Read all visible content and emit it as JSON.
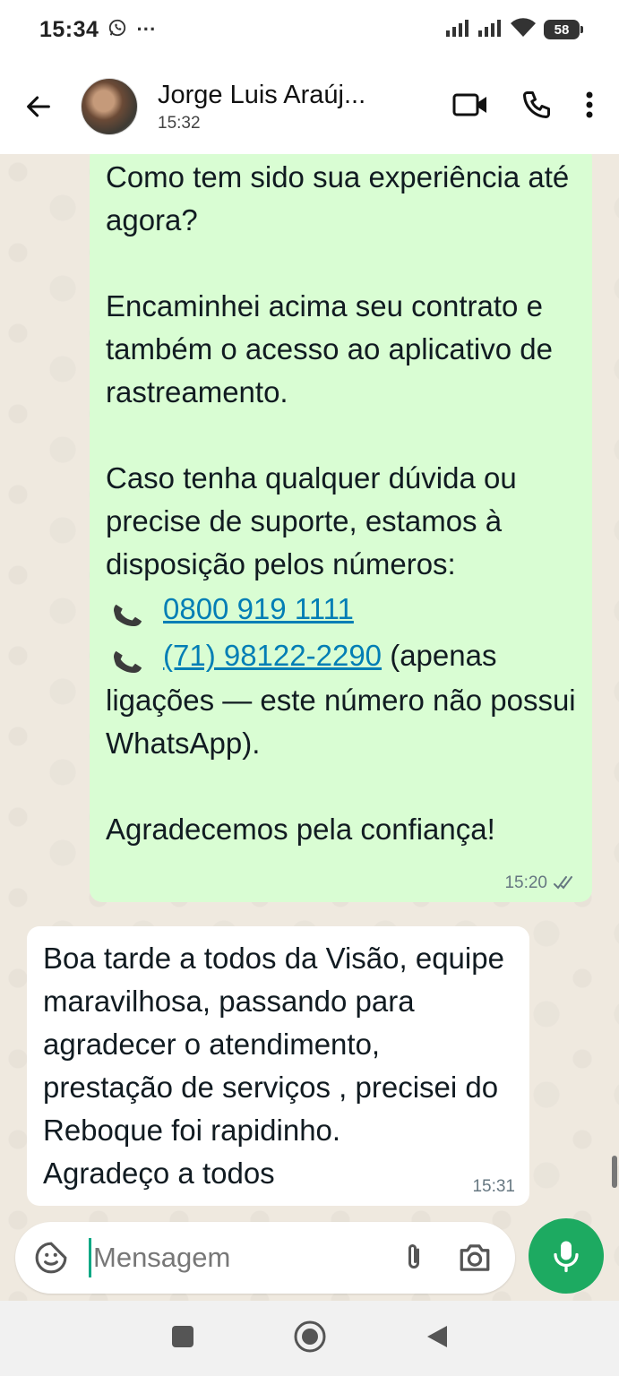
{
  "status_bar": {
    "time": "15:34",
    "battery": "58",
    "notif_dots": "···"
  },
  "header": {
    "contact_name": "Jorge Luis Araúj...",
    "last_seen": "15:32"
  },
  "messages": {
    "outgoing": {
      "text_1": "Como tem sido sua experiência até agora?\n\nEncaminhei acima seu contrato e também o acesso ao aplicativo de rastreamento.\n\nCaso tenha qualquer dúvida ou precise de suporte, estamos à disposição pelos números:",
      "phone_1": "0800 919 1111",
      "phone_2": "(71) 98122-2290",
      "phone_2_suffix": " (apenas",
      "text_2": "ligações — este número não possui WhatsApp).\n\nAgradecemos pela confiança!",
      "time": "15:20"
    },
    "incoming": {
      "text": "Boa tarde a todos da Visão, equipe maravilhosa, passando para agradecer o atendimento, prestação de serviços , precisei do Reboque foi rapidinho.\nAgradeço a todos",
      "time": "15:31"
    }
  },
  "composer": {
    "placeholder": "Mensagem"
  },
  "colors": {
    "outgoing_bubble": "#d9fdd3",
    "accent": "#1daa61",
    "link": "#027eb5",
    "chat_bg": "#efe9df"
  }
}
